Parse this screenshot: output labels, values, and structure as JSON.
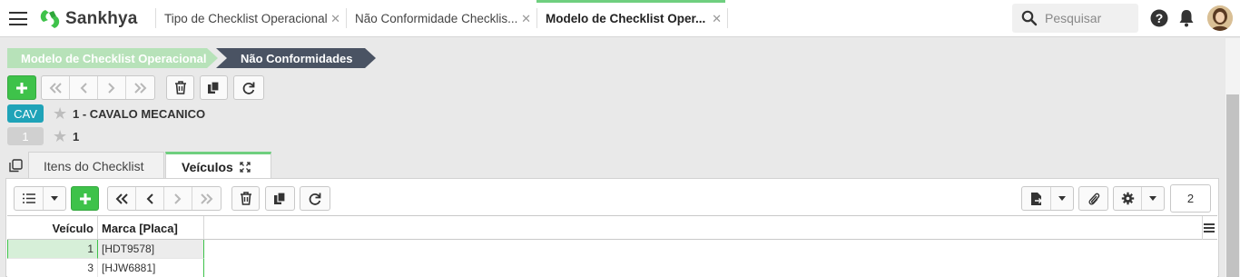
{
  "app": {
    "brand": "Sankhya",
    "brand_color": "#3ec24a"
  },
  "tabs": [
    {
      "label": "Tipo de Checklist Operacional",
      "active": false
    },
    {
      "label": "Não Conformidade Checklis...",
      "active": false
    },
    {
      "label": "Modelo de Checklist Oper...",
      "active": true
    }
  ],
  "search": {
    "placeholder": "Pesquisar"
  },
  "breadcrumb": [
    {
      "label": "Modelo de Checklist Operacional"
    },
    {
      "label": "Não Conformidades"
    }
  ],
  "header_rows": [
    {
      "badge": "CAV",
      "badge_color": "#1fa3b8",
      "text": "1 - CAVALO MECANICO"
    },
    {
      "badge": "1",
      "badge_color": "#d0d0d0",
      "text": "1"
    }
  ],
  "detail_tabs": [
    {
      "label": "Itens do Checklist",
      "active": false
    },
    {
      "label": "Veículos",
      "active": true
    }
  ],
  "pager": {
    "value": "2"
  },
  "grid": {
    "columns": [
      "Veículo",
      "Marca [Placa]"
    ],
    "rows": [
      {
        "veiculo": "1",
        "marca": "[HDT9578]",
        "selected": true
      },
      {
        "veiculo": "3",
        "marca": "[HJW6881]",
        "selected": false
      }
    ]
  }
}
